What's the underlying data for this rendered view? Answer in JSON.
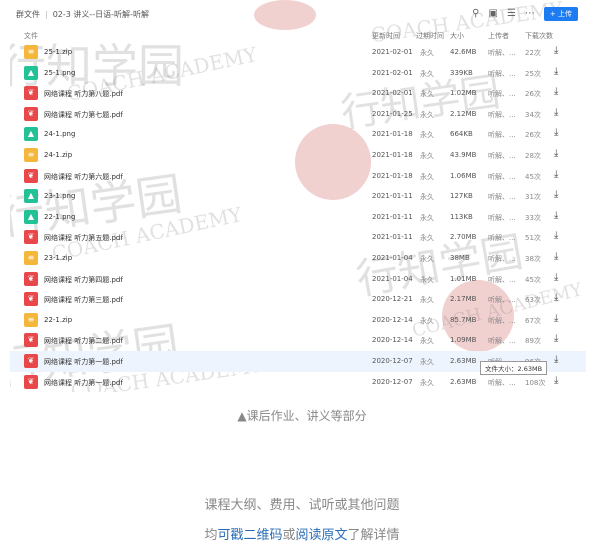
{
  "toolbar": {
    "breadcrumb_root": "群文件",
    "breadcrumb_sep": "|",
    "breadcrumb_path": "02-3 讲义--日语-听解-听解",
    "upload_label": "+ 上传"
  },
  "table": {
    "headers": {
      "name": "文件",
      "date": "更新时间",
      "expire": "过期时间",
      "size": "大小",
      "uploader": "上传者",
      "downloads": "下载次数"
    },
    "rows": [
      {
        "type": "zip",
        "name": "25-1.zip",
        "date": "2021-02-01",
        "expire": "永久",
        "size": "42.6MB",
        "uploader": "听解、...",
        "downloads": "22次"
      },
      {
        "type": "img",
        "name": "25-1.png",
        "date": "2021-02-01",
        "expire": "永久",
        "size": "339KB",
        "uploader": "听解、...",
        "downloads": "25次"
      },
      {
        "type": "pdf",
        "name": "网络课程 听力第八题.pdf",
        "date": "2021-02-01",
        "expire": "永久",
        "size": "1.02MB",
        "uploader": "听解、...",
        "downloads": "26次"
      },
      {
        "type": "pdf",
        "name": "网络课程 听力第七题.pdf",
        "date": "2021-01-25",
        "expire": "永久",
        "size": "2.12MB",
        "uploader": "听解、...",
        "downloads": "34次"
      },
      {
        "type": "img",
        "name": "24-1.png",
        "date": "2021-01-18",
        "expire": "永久",
        "size": "664KB",
        "uploader": "听解、...",
        "downloads": "26次"
      },
      {
        "type": "zip",
        "name": "24-1.zip",
        "date": "2021-01-18",
        "expire": "永久",
        "size": "43.9MB",
        "uploader": "听解、...",
        "downloads": "28次"
      },
      {
        "type": "pdf",
        "name": "网络课程 听力第六题.pdf",
        "date": "2021-01-18",
        "expire": "永久",
        "size": "1.06MB",
        "uploader": "听解、...",
        "downloads": "45次"
      },
      {
        "type": "img",
        "name": "23-1.png",
        "date": "2021-01-11",
        "expire": "永久",
        "size": "127KB",
        "uploader": "听解、...",
        "downloads": "31次"
      },
      {
        "type": "img",
        "name": "22-1.png",
        "date": "2021-01-11",
        "expire": "永久",
        "size": "113KB",
        "uploader": "听解、...",
        "downloads": "33次"
      },
      {
        "type": "pdf",
        "name": "网络课程 听力第五题.pdf",
        "date": "2021-01-11",
        "expire": "永久",
        "size": "2.70MB",
        "uploader": "听解、...",
        "downloads": "51次"
      },
      {
        "type": "zip",
        "name": "23-1.zip",
        "date": "2021-01-04",
        "expire": "永久",
        "size": "38MB",
        "uploader": "听解、...",
        "downloads": "38次"
      },
      {
        "type": "pdf",
        "name": "网络课程 听力第四题.pdf",
        "date": "2021-01-04",
        "expire": "永久",
        "size": "1.01MB",
        "uploader": "听解、...",
        "downloads": "45次"
      },
      {
        "type": "pdf",
        "name": "网络课程 听力第三题.pdf",
        "date": "2020-12-21",
        "expire": "永久",
        "size": "2.17MB",
        "uploader": "听解、...",
        "downloads": "63次"
      },
      {
        "type": "zip",
        "name": "22-1.zip",
        "date": "2020-12-14",
        "expire": "永久",
        "size": "85.7MB",
        "uploader": "听解、...",
        "downloads": "67次"
      },
      {
        "type": "pdf",
        "name": "网络课程 听力第二题.pdf",
        "date": "2020-12-14",
        "expire": "永久",
        "size": "1.09MB",
        "uploader": "听解、...",
        "downloads": "89次"
      },
      {
        "type": "pdf",
        "name": "网络课程 听力第一题.pdf",
        "date": "2020-12-07",
        "expire": "永久",
        "size": "2.63MB",
        "uploader": "听解、...",
        "downloads": "96次"
      },
      {
        "type": "pdf",
        "name": "网络课程 听力第一题.pdf",
        "date": "2020-12-07",
        "expire": "永久",
        "size": "2.63MB",
        "uploader": "听解、...",
        "downloads": "108次"
      }
    ],
    "highlight_row": 15
  },
  "tooltip": "文件大小：2.63MB",
  "watermark": {
    "cn": "行知学园",
    "en": "COACH ACADEMY"
  },
  "caption": "▲课后作业、讲义等部分",
  "info_line1": "课程大纲、费用、试听或其他问题",
  "info_line2": {
    "pre": "均",
    "link1": "可戳二维码",
    "mid": "或",
    "link2": "阅读原文",
    "post": "了解详情"
  }
}
